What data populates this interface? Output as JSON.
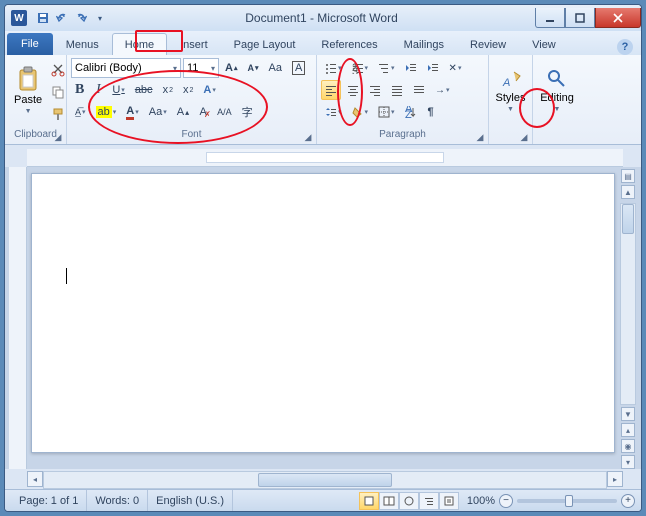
{
  "title": "Document1 - Microsoft Word",
  "app_letter": "W",
  "tabs": {
    "file": "File",
    "items": [
      "Menus",
      "Home",
      "Insert",
      "Page Layout",
      "References",
      "Mailings",
      "Review",
      "View"
    ],
    "active_index": 1
  },
  "clipboard": {
    "paste": "Paste",
    "label": "Clipboard"
  },
  "font": {
    "family": "Calibri (Body)",
    "size": "11",
    "label": "Font",
    "bold": "B",
    "italic": "I",
    "underline": "U",
    "strike": "abc",
    "sub": "x",
    "sup": "x",
    "grow": "A",
    "shrink": "A",
    "case": "Aa",
    "clear": "A"
  },
  "paragraph": {
    "label": "Paragraph"
  },
  "styles": {
    "label": "Styles"
  },
  "editing": {
    "label": "Editing"
  },
  "status": {
    "page": "Page: 1 of 1",
    "words": "Words: 0",
    "lang": "English (U.S.)",
    "zoom": "100%"
  }
}
